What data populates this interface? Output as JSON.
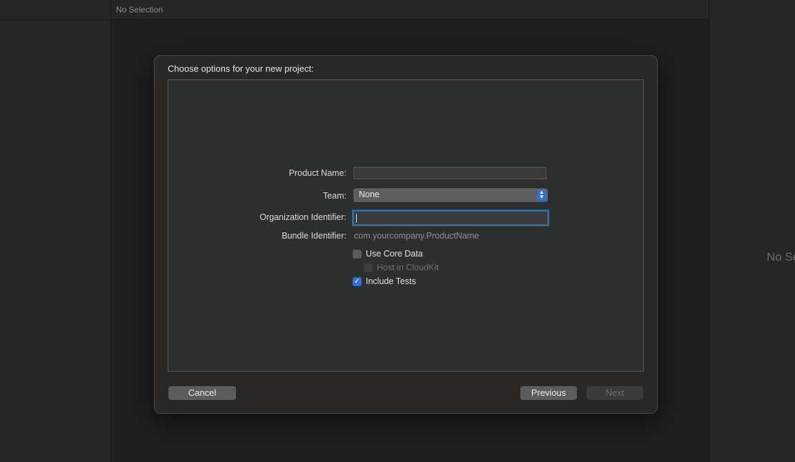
{
  "background": {
    "center_header": "No Selection",
    "right_pane_text": "No Se"
  },
  "dialog": {
    "title": "Choose options for your new project:",
    "form": {
      "product_name_label": "Product Name:",
      "product_name_value": "",
      "team_label": "Team:",
      "team_value": "None",
      "org_identifier_label": "Organization Identifier:",
      "org_identifier_value": "",
      "bundle_identifier_label": "Bundle Identifier:",
      "bundle_identifier_value": "com.yourcompany.ProductName",
      "options": [
        {
          "label": "Use Core Data",
          "checked": false,
          "enabled": true
        },
        {
          "label": "Host in CloudKit",
          "checked": false,
          "enabled": false
        },
        {
          "label": "Include Tests",
          "checked": true,
          "enabled": true
        }
      ]
    },
    "buttons": {
      "cancel": "Cancel",
      "previous": "Previous",
      "next": "Next"
    }
  },
  "colors": {
    "accent": "#2f6fd6",
    "focus_ring": "#2f6a99"
  }
}
